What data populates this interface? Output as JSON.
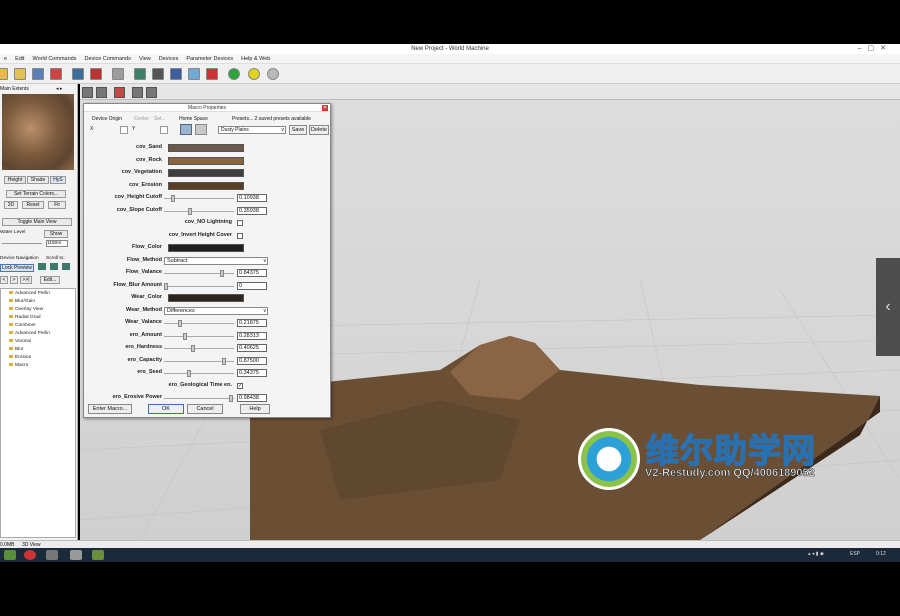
{
  "window": {
    "title": "New Project - World Machine"
  },
  "menu": [
    "e",
    "Edit",
    "World Commands",
    "Device Commands",
    "View",
    "Devices",
    "Parameter Devices",
    "Help & Web"
  ],
  "leftpanel": {
    "tab_label": "Main Extents",
    "arrows": "◂ ▸",
    "view_buttons": [
      "Height",
      "Shade",
      "HyS"
    ],
    "set_terrain_colors": "Set Terrain Colors...",
    "mode_buttons": [
      "3D",
      "Reset",
      "Fit"
    ],
    "toggle_main_view": "Toggle Main View",
    "water_level_label": "Water Level",
    "show_label": "Show",
    "water_level_value": "1150m",
    "device_navigation": "Device Navigation",
    "scroll_to": "Scroll to:",
    "lock_preview": "Lock Preview",
    "nav_buttons": [
      "<",
      ">",
      ">>|",
      "Edit..."
    ],
    "tree": [
      "Advanced Perlin",
      "Blur/Gain",
      "Overlay View",
      "Radial Grad",
      "Combiner",
      "Advanced Perlin",
      "Voronoi",
      "Blur",
      "Erosion",
      "Macro"
    ]
  },
  "dialog": {
    "title": "Macro Properties",
    "device_origin": "Device Origin",
    "center": "Center",
    "set": "Set...",
    "home_space": "Home Space",
    "presets_label": "Presets... 2 saved presets available",
    "x_label": "X",
    "y_label": "Y",
    "preset_value": "Dusty Plains",
    "save": "Save",
    "delete": "Delete",
    "params": [
      {
        "label": "cov_Sand",
        "kind": "color",
        "color": "#6b5a4b"
      },
      {
        "label": "cov_Rock",
        "kind": "color",
        "color": "#8b6440"
      },
      {
        "label": "cov_Vegetation",
        "kind": "color",
        "color": "#3e3e3e"
      },
      {
        "label": "cov_Erosion",
        "kind": "color",
        "color": "#5a3e24"
      },
      {
        "label": "cov_Height Cutoff",
        "kind": "slider",
        "value": "0.10938",
        "pos": 0.109
      },
      {
        "label": "cov_Slope Cutoff",
        "kind": "slider",
        "value": "0.35938",
        "pos": 0.359
      },
      {
        "label": "cov_NO Lightning",
        "kind": "check",
        "checked": false
      },
      {
        "label": "cov_Invert Height Cover",
        "kind": "check",
        "checked": false
      },
      {
        "label": "Flow_Color",
        "kind": "color",
        "color": "#1f1f1f"
      },
      {
        "label": "Flow_Method",
        "kind": "select",
        "value": "Subtract"
      },
      {
        "label": "Flow_Valance",
        "kind": "slider",
        "value": "0.84375",
        "pos": 0.844
      },
      {
        "label": "Flow_Blur Amount",
        "kind": "slider",
        "value": "0",
        "pos": 0
      },
      {
        "label": "Wear_Color",
        "kind": "color",
        "color": "#2e241c"
      },
      {
        "label": "Wear_Method",
        "kind": "select",
        "value": "Differences"
      },
      {
        "label": "Wear_Valance",
        "kind": "slider",
        "value": "0.21875",
        "pos": 0.219
      },
      {
        "label": "ero_Amount",
        "kind": "slider",
        "value": "0.28313",
        "pos": 0.283
      },
      {
        "label": "ero_Hardness",
        "kind": "slider",
        "value": "0.40625",
        "pos": 0.406
      },
      {
        "label": "ero_Capacity",
        "kind": "slider",
        "value": "0.87500",
        "pos": 0.875
      },
      {
        "label": "ero_Seed",
        "kind": "slider",
        "value": "0.34375",
        "pos": 0.344
      },
      {
        "label": "ero_Geological Time en.",
        "kind": "check",
        "checked": true
      },
      {
        "label": "ero_Erosive Power",
        "kind": "slider",
        "value": "0.98438",
        "pos": 0.984
      }
    ],
    "enter_macro": "Enter Macro...",
    "ok": "OK",
    "cancel": "Cancel",
    "help": "Help"
  },
  "statusbar": {
    "mem": "0.0MB",
    "view": "3D View"
  },
  "taskbar": {
    "lang": "ESP",
    "time": "0:12"
  },
  "watermark": {
    "title": "维尔助学网",
    "subtitle": "V2-Restudy.com QQ/4006189052"
  }
}
